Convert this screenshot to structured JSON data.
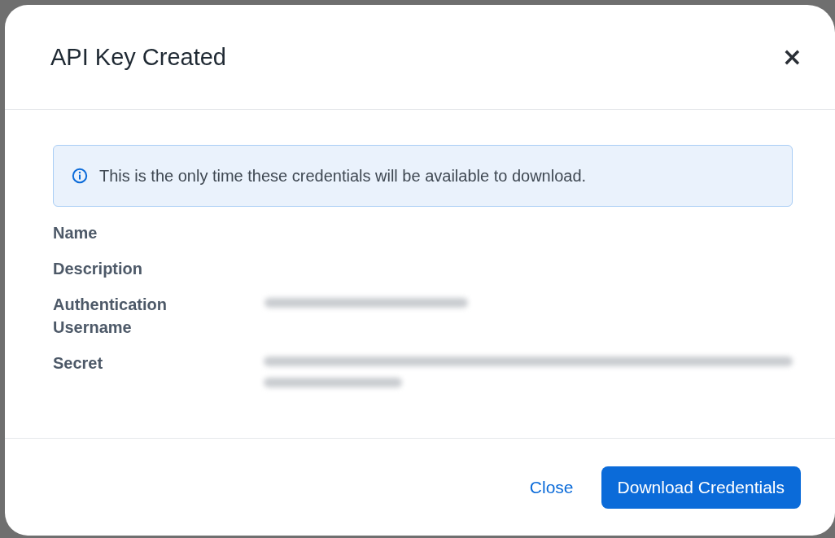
{
  "dialog": {
    "title": "API Key Created",
    "close_icon": "×"
  },
  "notice": {
    "text": "This is the only time these credentials will be available to download."
  },
  "fields": [
    {
      "label": "Name",
      "kind": "blank"
    },
    {
      "label": "Description",
      "kind": "blank"
    },
    {
      "label": "Authentication Username",
      "kind": "blurred"
    },
    {
      "label": "Secret",
      "kind": "blurredlong"
    }
  ],
  "buttons": [
    {
      "label": "Close",
      "kind": "link"
    },
    {
      "label": "Download Credentials",
      "kind": "primary"
    }
  ]
}
